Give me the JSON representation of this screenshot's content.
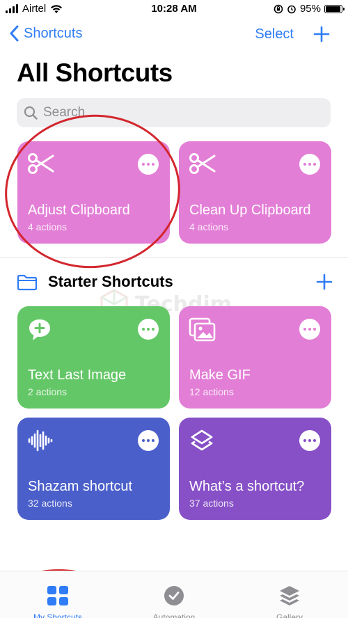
{
  "status_bar": {
    "carrier": "Airtel",
    "time": "10:28 AM",
    "battery": "95%",
    "battery_level": 0.95,
    "icons": [
      "signal-icon",
      "wifi-icon",
      "orientation-lock-icon",
      "alarm-icon",
      "battery-icon"
    ]
  },
  "nav": {
    "back_label": "Shortcuts",
    "select_label": "Select",
    "add_icon": "plus-icon"
  },
  "page": {
    "title": "All Shortcuts"
  },
  "search": {
    "placeholder": "Search"
  },
  "my_shortcuts": [
    {
      "title": "Adjust Clipboard",
      "subtitle": "4 actions",
      "color": "#e37ed6",
      "icon": "scissors-icon"
    },
    {
      "title": "Clean Up Clipboard",
      "subtitle": "4 actions",
      "color": "#e37ed6",
      "icon": "scissors-icon"
    }
  ],
  "starter_section": {
    "title": "Starter Shortcuts",
    "icon": "folder-icon"
  },
  "starter_shortcuts": [
    {
      "title": "Text Last Image",
      "subtitle": "2 actions",
      "color": "#64c767",
      "icon": "message-plus-icon"
    },
    {
      "title": "Make GIF",
      "subtitle": "12 actions",
      "color": "#e37ed6",
      "icon": "photos-icon"
    },
    {
      "title": "Shazam shortcut",
      "subtitle": "32 actions",
      "color": "#4a5fca",
      "icon": "waveform-icon"
    },
    {
      "title": "What’s a shortcut?",
      "subtitle": "37 actions",
      "color": "#8750c7",
      "icon": "layers-icon"
    }
  ],
  "watermark": {
    "text": "Techdim"
  },
  "tab_bar": {
    "tabs": [
      {
        "label": "My Shortcuts",
        "icon": "grid-icon",
        "active": true
      },
      {
        "label": "Automation",
        "icon": "clock-check-icon",
        "active": false
      },
      {
        "label": "Gallery",
        "icon": "stack-icon",
        "active": false
      }
    ]
  },
  "colors": {
    "accent": "#2f7cf6",
    "annotation": "#d3262e"
  }
}
